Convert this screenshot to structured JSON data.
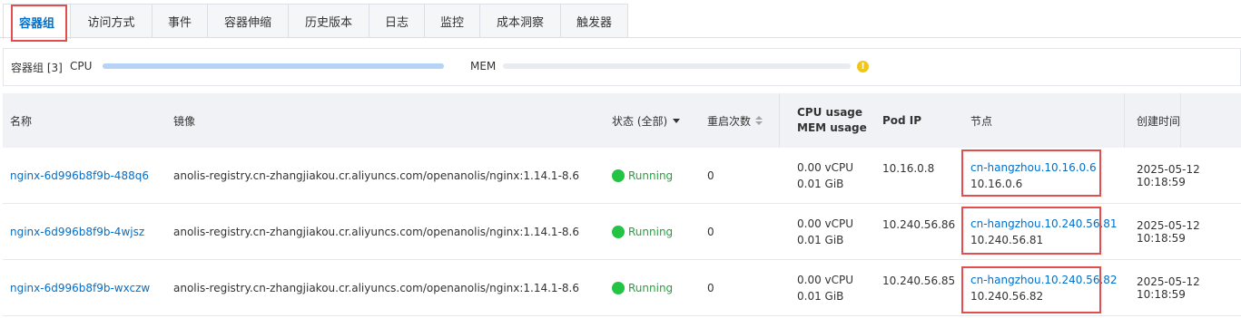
{
  "tabs": [
    {
      "label": "容器组",
      "active": true
    },
    {
      "label": "访问方式",
      "active": false
    },
    {
      "label": "事件",
      "active": false
    },
    {
      "label": "容器伸缩",
      "active": false
    },
    {
      "label": "历史版本",
      "active": false
    },
    {
      "label": "日志",
      "active": false
    },
    {
      "label": "监控",
      "active": false
    },
    {
      "label": "成本洞察",
      "active": false
    },
    {
      "label": "触发器",
      "active": false
    }
  ],
  "resource_bar": {
    "pods_label": "容器组 [3]",
    "cpu_label": "CPU",
    "mem_label": "MEM",
    "cpu_level": 1.0,
    "mem_level": 0.0,
    "warning_icon": "warning-icon"
  },
  "table": {
    "headers": {
      "name": "名称",
      "image": "镜像",
      "status": "状态 (全部)",
      "restarts": "重启次数",
      "cpu_usage": "CPU usage",
      "mem_usage": "MEM usage",
      "pod_ip": "Pod IP",
      "node": "节点",
      "created": "创建时间"
    },
    "rows": [
      {
        "name": "nginx-6d996b8f9b-488q6",
        "image": "anolis-registry.cn-zhangjiakou.cr.aliyuncs.com/openanolis/nginx:1.14.1-8.6",
        "status": "Running",
        "restarts": "0",
        "cpu": "0.00 vCPU",
        "mem": "0.01 GiB",
        "pod_ip": "10.16.0.8",
        "node_name": "cn-hangzhou.10.16.0.6",
        "node_ip": "10.16.0.6",
        "created": "2025-05-12 10:18:59"
      },
      {
        "name": "nginx-6d996b8f9b-4wjsz",
        "image": "anolis-registry.cn-zhangjiakou.cr.aliyuncs.com/openanolis/nginx:1.14.1-8.6",
        "status": "Running",
        "restarts": "0",
        "cpu": "0.00 vCPU",
        "mem": "0.01 GiB",
        "pod_ip": "10.240.56.86",
        "node_name": "cn-hangzhou.10.240.56.81",
        "node_ip": "10.240.56.81",
        "created": "2025-05-12 10:18:59"
      },
      {
        "name": "nginx-6d996b8f9b-wxczw",
        "image": "anolis-registry.cn-zhangjiakou.cr.aliyuncs.com/openanolis/nginx:1.14.1-8.6",
        "status": "Running",
        "restarts": "0",
        "cpu": "0.00 vCPU",
        "mem": "0.01 GiB",
        "pod_ip": "10.240.56.85",
        "node_name": "cn-hangzhou.10.240.56.82",
        "node_ip": "10.240.56.82",
        "created": "2025-05-12 10:18:59"
      }
    ]
  },
  "colors": {
    "accent": "#0070cc",
    "highlight": "#e34d4d",
    "running": "#23c343",
    "warning": "#f0c61b"
  }
}
